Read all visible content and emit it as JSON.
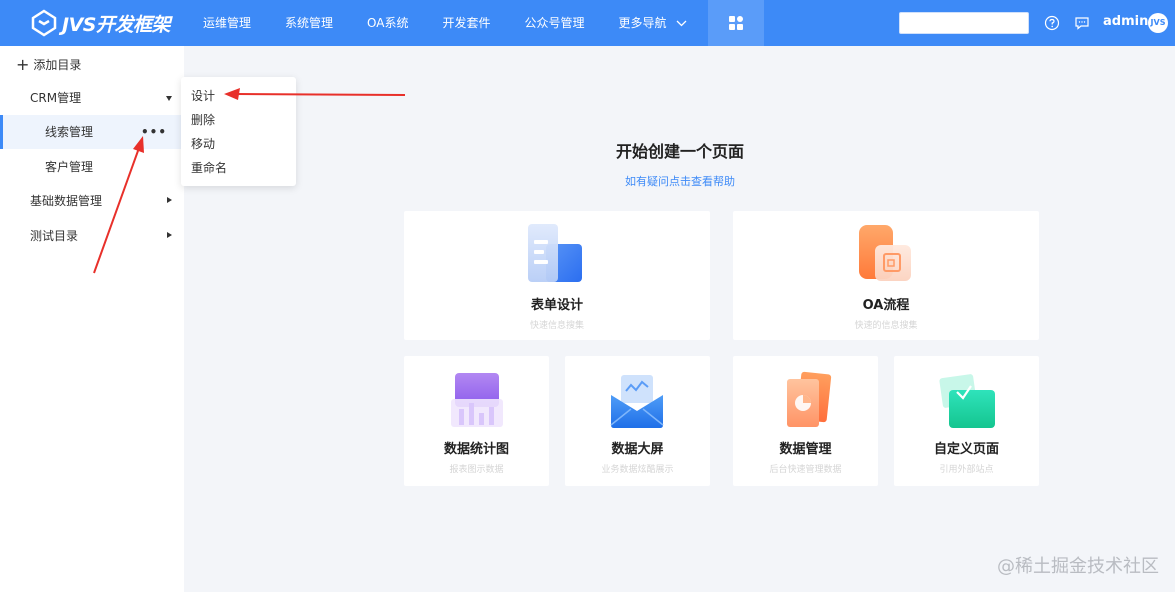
{
  "header": {
    "brand": "JVS开发框架",
    "nav": [
      "运维管理",
      "系统管理",
      "OA系统",
      "开发套件",
      "公众号管理",
      "更多导航"
    ],
    "user": "admin",
    "avatar_text": "JVS",
    "colors": {
      "primary": "#3d8af7"
    }
  },
  "sidebar": {
    "add_label": "添加目录",
    "items": [
      {
        "label": "CRM管理"
      },
      {
        "label": "线索管理"
      },
      {
        "label": "客户管理"
      },
      {
        "label": "基础数据管理"
      },
      {
        "label": "测试目录"
      }
    ]
  },
  "context_menu": {
    "items": [
      "设计",
      "删除",
      "移动",
      "重命名"
    ]
  },
  "main": {
    "title": "开始创建一个页面",
    "help": "如有疑问点击查看帮助",
    "cards": [
      {
        "title": "表单设计",
        "desc": "快速信息搜集"
      },
      {
        "title": "OA流程",
        "desc": "快速的信息搜集"
      },
      {
        "title": "数据统计图",
        "desc": "报表图示数据"
      },
      {
        "title": "数据大屏",
        "desc": "业务数据炫酷展示"
      },
      {
        "title": "数据管理",
        "desc": "后台快速管理数据"
      },
      {
        "title": "自定义页面",
        "desc": "引用外部站点"
      }
    ]
  },
  "watermark": "@稀土掘金技术社区"
}
